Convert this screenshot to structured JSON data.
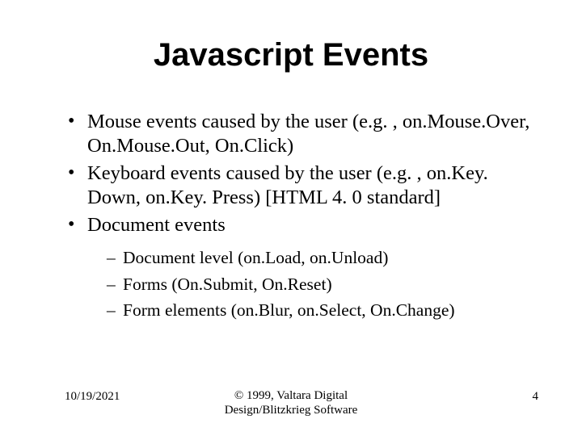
{
  "slide": {
    "title": "Javascript Events",
    "bullets": [
      {
        "text": "Mouse events caused by the user (e.g. , on.Mouse.Over, On.Mouse.Out, On.Click)"
      },
      {
        "text": "Keyboard events caused by the user (e.g. , on.Key. Down, on.Key. Press) [HTML 4. 0 standard]"
      },
      {
        "text": "Document events",
        "sub": [
          "Document level (on.Load, on.Unload)",
          "Forms (On.Submit, On.Reset)",
          "Form elements (on.Blur, on.Select, On.Change)"
        ]
      }
    ],
    "footer": {
      "date": "10/19/2021",
      "center_line1": "© 1999, Valtara Digital",
      "center_line2": "Design/Blitzkrieg Software",
      "page": "4"
    }
  }
}
